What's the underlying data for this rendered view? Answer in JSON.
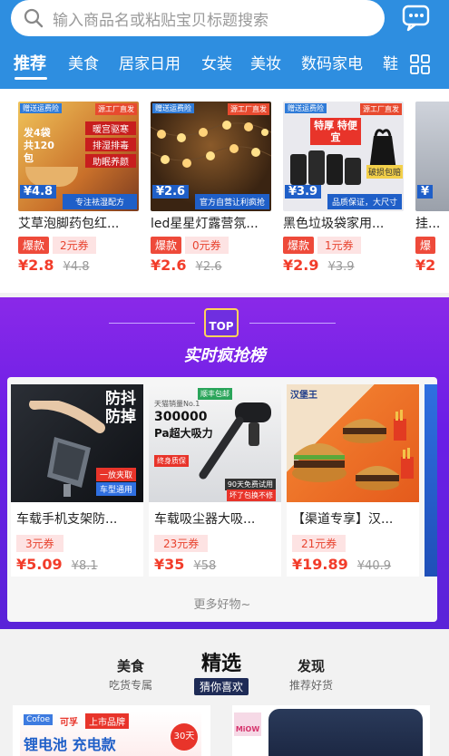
{
  "search": {
    "placeholder": "输入商品名或粘贴宝贝标题搜索"
  },
  "nav_tabs": [
    "推荐",
    "美食",
    "居家日用",
    "女装",
    "美妆",
    "数码家电",
    "鞋"
  ],
  "products": [
    {
      "title": "艾草泡脚药包红...",
      "hot": "爆款",
      "coupon": "2元券",
      "price": "¥2.8",
      "original": "¥4.8",
      "img": {
        "tag_left": "赠送运费险",
        "tag_right": "源工厂直发",
        "headline": "发4袋 共120包",
        "bullets": [
          "暖宫驱寒",
          "排湿排毒",
          "助眠养颜"
        ],
        "price_flag": "¥4.8",
        "band": "专注祛湿配方"
      }
    },
    {
      "title": "led星星灯露营氛...",
      "hot": "爆款",
      "coupon": "0元券",
      "price": "¥2.6",
      "original": "¥2.6",
      "img": {
        "tag_left": "赠送运费险",
        "tag_right": "源工厂直发",
        "price_flag": "¥2.6",
        "band": "官方自营让利疯抢"
      }
    },
    {
      "title": "黑色垃圾袋家用...",
      "hot": "爆款",
      "coupon": "1元券",
      "price": "¥2.9",
      "original": "¥3.9",
      "img": {
        "tag_left": "赠送运费险",
        "tag_right": "源工厂直发",
        "headline": "特厚 特便宜",
        "side": "破损包赔",
        "price_flag": "¥3.9",
        "band": "品质保证，大尺寸"
      }
    },
    {
      "title": "挂...",
      "hot": "爆",
      "coupon": "",
      "price": "¥2",
      "original": "",
      "img": {
        "tag_left": "",
        "tag_right": "",
        "price_flag": "¥",
        "band": ""
      }
    }
  ],
  "flash": {
    "badge": "TOP",
    "title": "实时疯抢榜",
    "more": "更多好物~",
    "items": [
      {
        "title": "车载手机支架防...",
        "coupon": "3元券",
        "price": "¥5.09",
        "original": "¥8.1",
        "img": {
          "line1": "防抖",
          "line2": "防掉",
          "tag1": "一放夹取",
          "tag2": "车型通用"
        }
      },
      {
        "title": "车载吸尘器大吸...",
        "coupon": "23元券",
        "price": "¥35",
        "original": "¥58",
        "img": {
          "brand": "顺丰包邮",
          "sub": "天猫销量No.1",
          "big": "300000",
          "unit": "Pa超大吸力",
          "tag": "终身质保",
          "note": "90天免费试用",
          "note2": "坏了包换不修"
        }
      },
      {
        "title": "【渠道专享】汉...",
        "coupon": "21元券",
        "price": "¥19.89",
        "original": "¥40.9",
        "img": {
          "brand": "汉堡王"
        }
      }
    ]
  },
  "bottom_tabs": [
    {
      "title": "美食",
      "sub": "吃货专属"
    },
    {
      "title": "精选",
      "sub": "猜你喜欢"
    },
    {
      "title": "发现",
      "sub": "推荐好货"
    }
  ],
  "feed": [
    {
      "brand": "Cofoe",
      "brand2": "可孚",
      "tag": "上市品牌",
      "headline": "锂电池 充电款",
      "badge": "30天"
    },
    {
      "brand": "MiOW"
    }
  ],
  "colors": {
    "header": "#2e8ee0",
    "accent": "#f23c2a",
    "flash_bg": "#6a1ee6"
  }
}
